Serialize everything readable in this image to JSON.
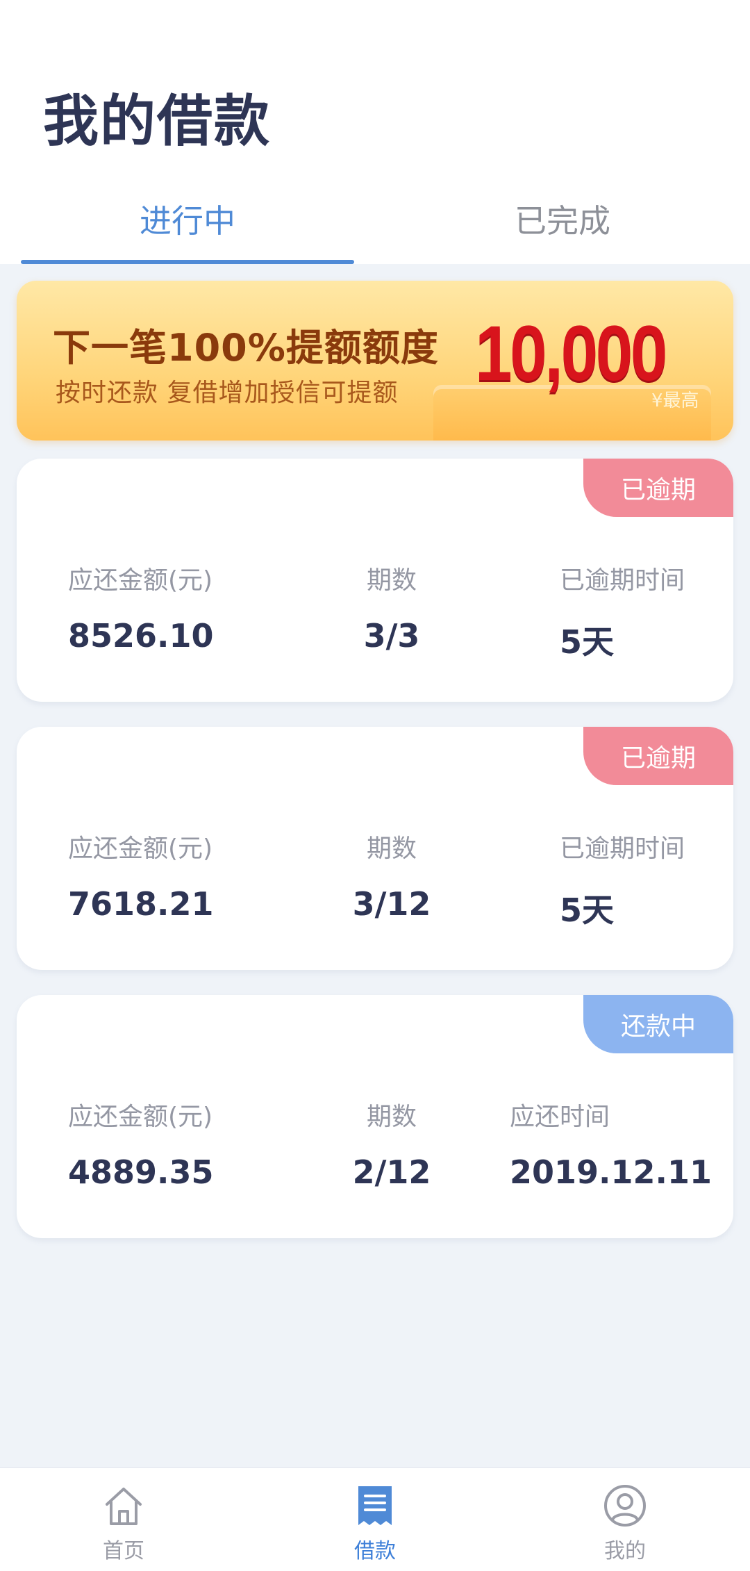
{
  "header": {
    "title": "我的借款",
    "tabs": [
      {
        "label": "进行中",
        "active": true
      },
      {
        "label": "已完成",
        "active": false
      }
    ]
  },
  "banner": {
    "title": "下一笔100%提额额度",
    "subtitle": "按时还款  复借增加授信可提额",
    "amount": "10,000",
    "tag": "¥最高"
  },
  "loans": [
    {
      "status": "已逾期",
      "amount_label": "应还金额(元)",
      "amount": "8526.10",
      "period_label": "期数",
      "period": "3/3",
      "time_label": "已逾期时间",
      "time": "5天"
    },
    {
      "status": "已逾期",
      "amount_label": "应还金额(元)",
      "amount": "7618.21",
      "period_label": "期数",
      "period": "3/12",
      "time_label": "已逾期时间",
      "time": "5天"
    },
    {
      "status": "还款中",
      "amount_label": "应还金额(元)",
      "amount": "4889.35",
      "period_label": "期数",
      "period": "2/12",
      "time_label": "应还时间",
      "time": "2019.12.11"
    }
  ],
  "nav": {
    "items": [
      {
        "label": "首页",
        "icon": "home-icon",
        "active": false
      },
      {
        "label": "借款",
        "icon": "document-list-icon",
        "active": true
      },
      {
        "label": "我的",
        "icon": "user-icon",
        "active": false
      }
    ]
  },
  "colors": {
    "accent": "#4f8ad6",
    "overdue": "#f28b98",
    "repaying": "#8cb4f0",
    "text_dark": "#2e3555",
    "background": "#eff3f8"
  }
}
